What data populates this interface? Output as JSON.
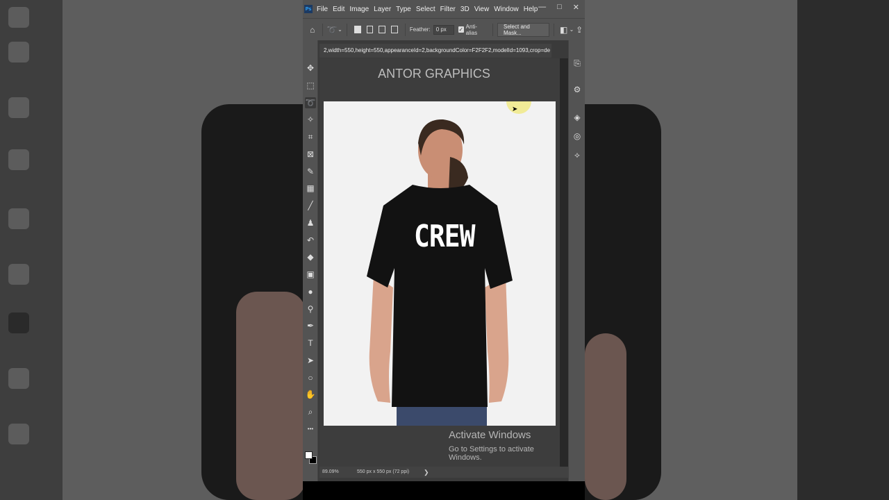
{
  "app": {
    "logo_text": "Ps"
  },
  "menu": [
    "File",
    "Edit",
    "Image",
    "Layer",
    "Type",
    "Select",
    "Filter",
    "3D",
    "View",
    "Window",
    "Help"
  ],
  "window_controls": {
    "minimize": "—",
    "restore": "□",
    "close": "✕"
  },
  "options_bar": {
    "feather_label": "Feather:",
    "feather_value": "0 px",
    "antialias_label": "Anti-alias",
    "select_mask_label": "Select and Mask..."
  },
  "document": {
    "tab_title": "2,width=550,height=550,appearanceId=2,backgroundColor=F2F2F2,modelId=1093,crop=de",
    "watermark": "ANTOR GRAPHICS",
    "shirt_text": "CREW",
    "background_color": "#F2F2F2"
  },
  "activation": {
    "title": "Activate Windows",
    "subtitle": "Go to Settings to activate Windows."
  },
  "status": {
    "zoom": "89.09%",
    "size": "550 px x 550 px (72 ppi)",
    "arrow": "❯"
  },
  "tools": [
    {
      "name": "move-tool",
      "icon": "✥"
    },
    {
      "name": "marquee-tool",
      "icon": "⬚"
    },
    {
      "name": "lasso-tool",
      "icon": "➰"
    },
    {
      "name": "magic-wand-tool",
      "icon": "✧"
    },
    {
      "name": "crop-tool",
      "icon": "⌗"
    },
    {
      "name": "frame-tool",
      "icon": "⊠"
    },
    {
      "name": "eyedropper-tool",
      "icon": "✎"
    },
    {
      "name": "healing-tool",
      "icon": "▦"
    },
    {
      "name": "brush-tool",
      "icon": "╱"
    },
    {
      "name": "stamp-tool",
      "icon": "♟"
    },
    {
      "name": "history-brush-tool",
      "icon": "↶"
    },
    {
      "name": "eraser-tool",
      "icon": "◆"
    },
    {
      "name": "gradient-tool",
      "icon": "▣"
    },
    {
      "name": "blur-tool",
      "icon": "●"
    },
    {
      "name": "dodge-tool",
      "icon": "⚲"
    },
    {
      "name": "pen-tool",
      "icon": "✒"
    },
    {
      "name": "type-tool",
      "icon": "T"
    },
    {
      "name": "path-selection-tool",
      "icon": "➤"
    },
    {
      "name": "shape-tool",
      "icon": "○"
    },
    {
      "name": "hand-tool",
      "icon": "✋"
    },
    {
      "name": "zoom-tool",
      "icon": "⌕"
    },
    {
      "name": "more-tools",
      "icon": "•••"
    }
  ],
  "dock": [
    {
      "name": "history-panel",
      "icon": "⎘"
    },
    {
      "name": "properties-panel",
      "icon": "⚙"
    },
    {
      "name": "layers-panel",
      "icon": "◈"
    },
    {
      "name": "channels-panel",
      "icon": "◎"
    },
    {
      "name": "paths-panel",
      "icon": "⟡"
    }
  ]
}
